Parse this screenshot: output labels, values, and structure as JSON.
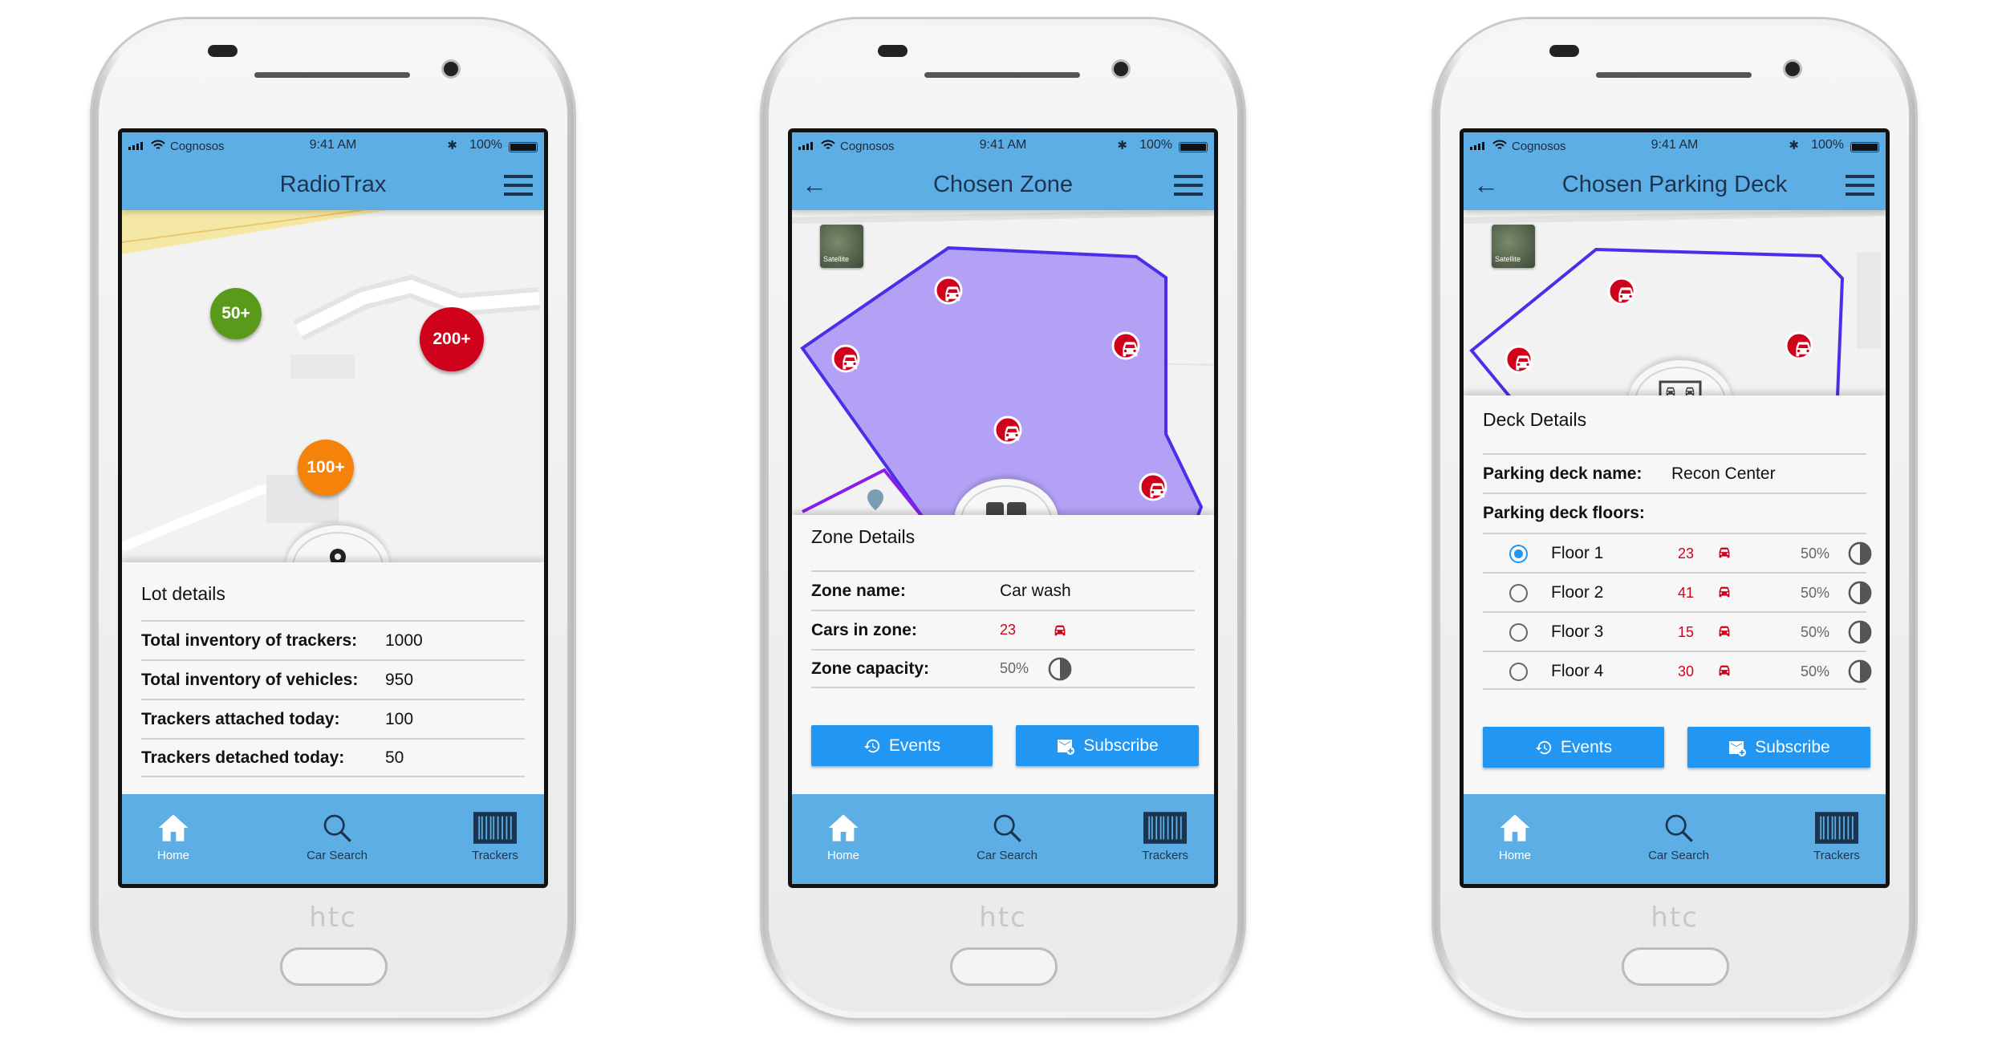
{
  "device_brand": "htc",
  "status_bar": {
    "carrier": "Cognosos",
    "time": "9:41 AM",
    "battery": "100%"
  },
  "bottom_nav": [
    {
      "label": "Home",
      "icon": "home-icon",
      "active": true
    },
    {
      "label": "Car Search",
      "icon": "search-icon",
      "active": false
    },
    {
      "label": "Trackers",
      "icon": "barcode-icon",
      "active": false
    }
  ],
  "colors": {
    "header": "#5eaee6",
    "button": "#2196f3",
    "alert_red": "#d0021b",
    "zone_fill": "#b3a1f5",
    "zone_stroke": "#4b2ee8"
  },
  "screens": [
    {
      "title": "RadioTrax",
      "map_clusters": [
        {
          "label": "50+",
          "color": "#5a9a1a"
        },
        {
          "label": "200+",
          "color": "#d0021b"
        },
        {
          "label": "100+",
          "color": "#f5820a"
        }
      ],
      "panel": {
        "title": "Lot details",
        "icon": "map-pin-icon",
        "rows": [
          {
            "label": "Total inventory of trackers:",
            "value": "1000"
          },
          {
            "label": "Total inventory of vehicles:",
            "value": "950"
          },
          {
            "label": "Trackers attached today:",
            "value": "100"
          },
          {
            "label": "Trackers detached today:",
            "value": "50"
          }
        ]
      }
    },
    {
      "title": "Chosen Zone",
      "satellite_label": "Satellite",
      "panel": {
        "title": "Zone Details",
        "icon": "dashboard-icon",
        "rows": [
          {
            "label": "Zone name:",
            "value": "Car wash"
          },
          {
            "label": "Cars in zone:",
            "value": "23"
          },
          {
            "label": "Zone capacity:",
            "value": "50%"
          }
        ],
        "buttons": {
          "events": "Events",
          "subscribe": "Subscribe"
        }
      }
    },
    {
      "title": "Chosen Parking Deck",
      "satellite_label": "Satellite",
      "panel": {
        "title": "Deck Details",
        "icon": "parking-deck-icon",
        "name_label": "Parking deck name:",
        "name_value": "Recon Center",
        "floors_label": "Parking deck floors:",
        "floors": [
          {
            "label": "Floor 1",
            "cars": "23",
            "capacity": "50%",
            "selected": true
          },
          {
            "label": "Floor 2",
            "cars": "41",
            "capacity": "50%",
            "selected": false
          },
          {
            "label": "Floor 3",
            "cars": "15",
            "capacity": "50%",
            "selected": false
          },
          {
            "label": "Floor 4",
            "cars": "30",
            "capacity": "50%",
            "selected": false
          }
        ],
        "buttons": {
          "events": "Events",
          "subscribe": "Subscribe"
        }
      }
    }
  ]
}
